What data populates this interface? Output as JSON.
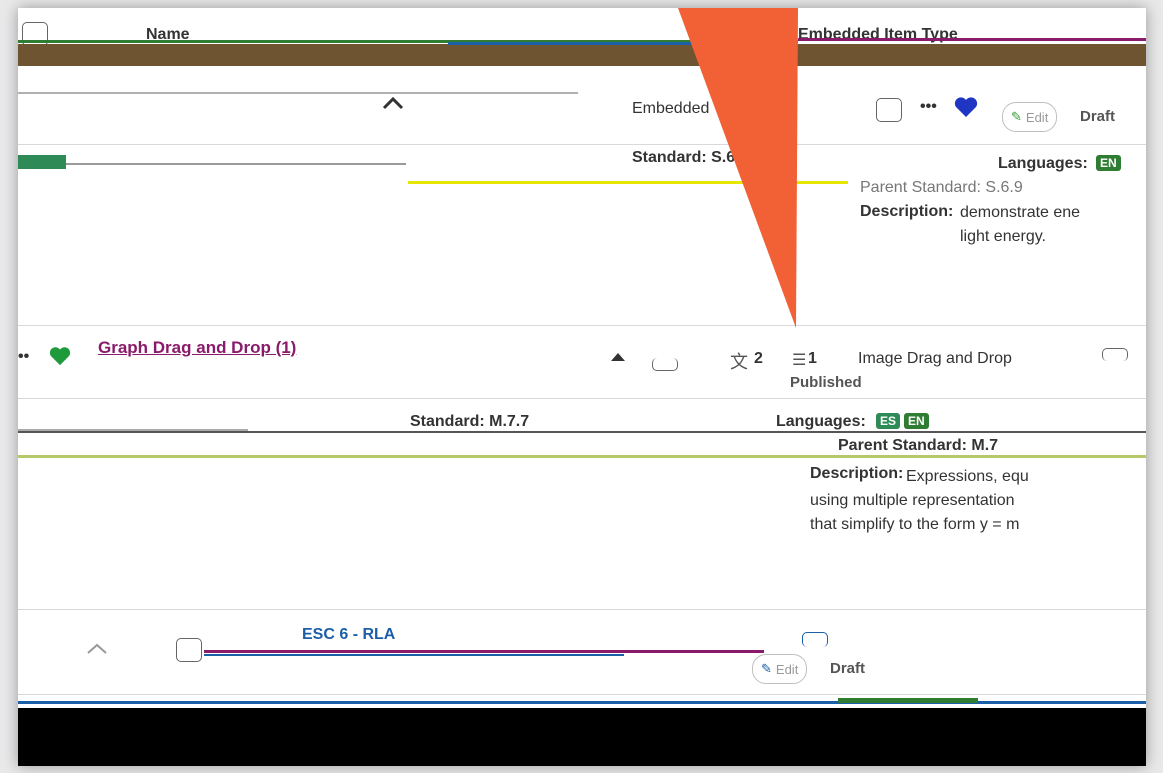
{
  "colors": {
    "accent_purple": "#8a1b6b",
    "esc_blue": "#1b5fa8",
    "heart_blue": "#1f35c4",
    "es_badge_green": "#2e8b57",
    "en_badge_green": "#2e7d32",
    "arrow_orange": "#f26135",
    "header_brown": "#6e5431"
  },
  "header": {
    "col_name": "Name",
    "col_type": "Embedded Item Type"
  },
  "rows": [
    {
      "type_label": "Embedded Vocabulary",
      "status": "Draft",
      "edit_label": "Edit",
      "standard": "Standard: S.6.9",
      "languages_label": "Languages:",
      "lang_badge": "EN",
      "parent_standard": "Parent Standard: S.6.9",
      "description_label": "Description:",
      "description": "demonstrate ene\nlight energy."
    },
    {
      "title": "Graph Drag and Drop (1)",
      "type_label": "Image Drag and Drop",
      "status": "Published",
      "translation_count": "2",
      "user_count": "1",
      "standard": "Standard: M.7.7",
      "languages_label": "Languages:",
      "lang_badges": [
        "ES",
        "EN"
      ],
      "parent_standard": "Parent Standard: M.7",
      "description_label": "Description:",
      "description": "Expressions, equ\nusing multiple representation\nthat simplify to the form y = m"
    },
    {
      "title": "ESC 6 - RLA",
      "status": "Draft",
      "edit_label": "Edit"
    }
  ],
  "icons": [
    "chevron-up-icon",
    "more-icon",
    "heart-icon",
    "pencil-icon",
    "translate-icon",
    "user-icon",
    "arrow-annotation"
  ]
}
